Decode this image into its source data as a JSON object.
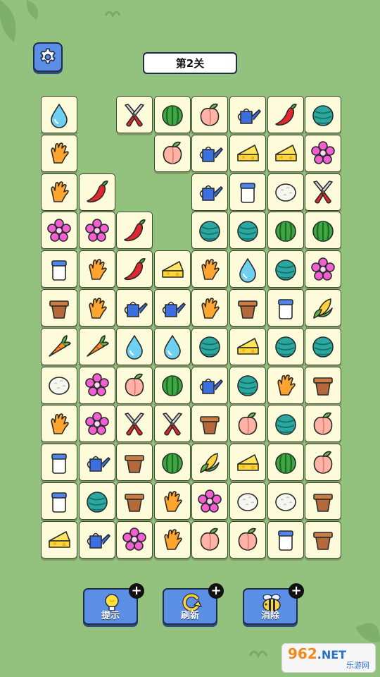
{
  "header": {
    "level_title": "第2关"
  },
  "settings": {
    "icon": "gear-icon"
  },
  "tile_types": [
    "water-drop",
    "pruning-shears",
    "watermelon",
    "peach",
    "watering-can",
    "chili-pepper",
    "yarn-ball",
    "gardening-glove",
    "cheese",
    "pink-flower",
    "milk-jar",
    "rice-ball",
    "flower-pot",
    "corn",
    "carrot"
  ],
  "board": {
    "rows": 12,
    "cols": 8,
    "grid": [
      [
        "water-drop",
        null,
        "pruning-shears",
        "watermelon",
        "peach",
        "watering-can",
        "chili-pepper",
        "yarn-ball"
      ],
      [
        "gardening-glove",
        null,
        null,
        "peach",
        "watering-can",
        "cheese",
        "cheese",
        "pink-flower"
      ],
      [
        "gardening-glove",
        "chili-pepper",
        null,
        null,
        "watering-can",
        "milk-jar",
        "rice-ball",
        "pruning-shears"
      ],
      [
        "pink-flower",
        "pink-flower",
        "chili-pepper",
        null,
        "yarn-ball",
        "yarn-ball",
        "watermelon",
        "watermelon"
      ],
      [
        "milk-jar",
        "gardening-glove",
        "chili-pepper",
        "cheese",
        "gardening-glove",
        "water-drop",
        "yarn-ball",
        "pink-flower"
      ],
      [
        "flower-pot",
        "gardening-glove",
        "watering-can",
        "watering-can",
        "gardening-glove",
        "flower-pot",
        "milk-jar",
        "corn"
      ],
      [
        "carrot",
        "carrot",
        "water-drop",
        "water-drop",
        "yarn-ball",
        "cheese",
        "yarn-ball",
        "yarn-ball"
      ],
      [
        "rice-ball",
        "pink-flower",
        "peach",
        "watermelon",
        "watering-can",
        "yarn-ball",
        "gardening-glove",
        "flower-pot"
      ],
      [
        "gardening-glove",
        "pink-flower",
        "pruning-shears",
        "pruning-shears",
        "flower-pot",
        "peach",
        "yarn-ball",
        "peach"
      ],
      [
        "milk-jar",
        "watering-can",
        "flower-pot",
        "watermelon",
        "corn",
        "cheese",
        "watermelon",
        "peach"
      ],
      [
        "milk-jar",
        "yarn-ball",
        "flower-pot",
        "gardening-glove",
        "pink-flower",
        "rice-ball",
        "rice-ball",
        "flower-pot"
      ],
      [
        "cheese",
        "watering-can",
        "pink-flower",
        "gardening-glove",
        "peach",
        "peach",
        "milk-jar",
        "flower-pot"
      ]
    ]
  },
  "powerups": [
    {
      "id": "hint",
      "label": "提示",
      "icon": "lightbulb-icon",
      "badge": "+"
    },
    {
      "id": "refresh",
      "label": "刷新",
      "icon": "refresh-icon",
      "badge": "+"
    },
    {
      "id": "eliminate",
      "label": "消除",
      "icon": "bee-icon",
      "badge": "+"
    }
  ],
  "watermark": {
    "brand_num": "962",
    "brand_net": ".NET",
    "brand_sub": "乐游网"
  },
  "colors": {
    "background": "#93c27f",
    "tile_face": "#fdfbd9",
    "button_blue": "#5b8fe6",
    "outline": "#1f2d4a"
  }
}
